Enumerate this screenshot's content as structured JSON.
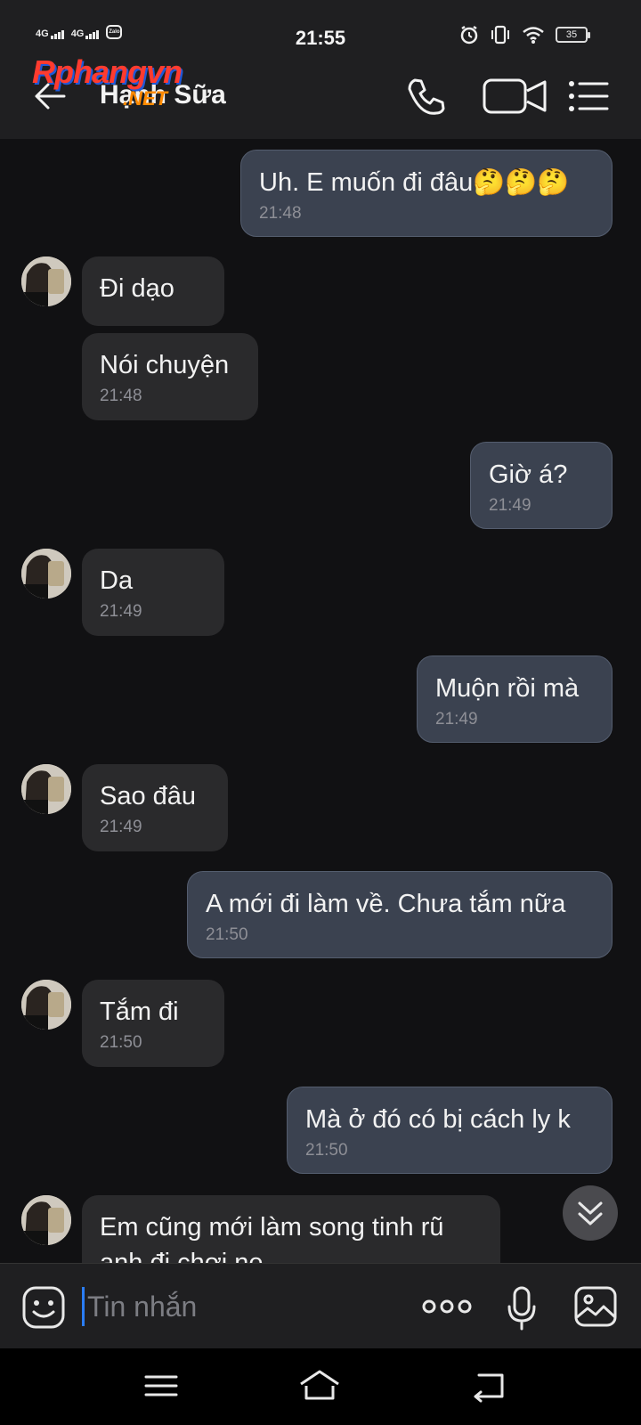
{
  "status_bar": {
    "time": "21:55",
    "network_1": "4G",
    "network_2": "4G",
    "app_badge": "Zalo",
    "battery": "35"
  },
  "header": {
    "contact_name": "Hạnh Sữa",
    "watermark_main": "Rphangvn",
    "watermark_sub": ".NET"
  },
  "messages": [
    {
      "dir": "out",
      "text": "Uh. E muốn đi đâu🤔🤔🤔",
      "time": "21:48"
    },
    {
      "dir": "in",
      "text": "Đi dạo",
      "time": ""
    },
    {
      "dir": "in",
      "text": "Nói chuyện",
      "time": "21:48"
    },
    {
      "dir": "out",
      "text": "Giờ á?",
      "time": "21:49"
    },
    {
      "dir": "in",
      "text": "Da",
      "time": "21:49"
    },
    {
      "dir": "out",
      "text": "Muộn rồi mà",
      "time": "21:49"
    },
    {
      "dir": "in",
      "text": "Sao đâu",
      "time": "21:49"
    },
    {
      "dir": "out",
      "text": "A mới đi làm về. Chưa tắm nữa",
      "time": "21:50"
    },
    {
      "dir": "in",
      "text": "Tắm đi",
      "time": "21:50"
    },
    {
      "dir": "out",
      "text": "Mà ở đó có bị cách ly k",
      "time": "21:50"
    },
    {
      "dir": "in",
      "text": "Em cũng mới làm song tinh rũ",
      "text2": "anh đi chơi ne",
      "time": ""
    }
  ],
  "composer": {
    "placeholder": "Tin nhắn"
  },
  "colors": {
    "background": "#111113",
    "bar": "#1f1f21",
    "bubble_out": "#3b4250",
    "bubble_in": "#2a2a2c",
    "caret": "#2a7df6"
  }
}
